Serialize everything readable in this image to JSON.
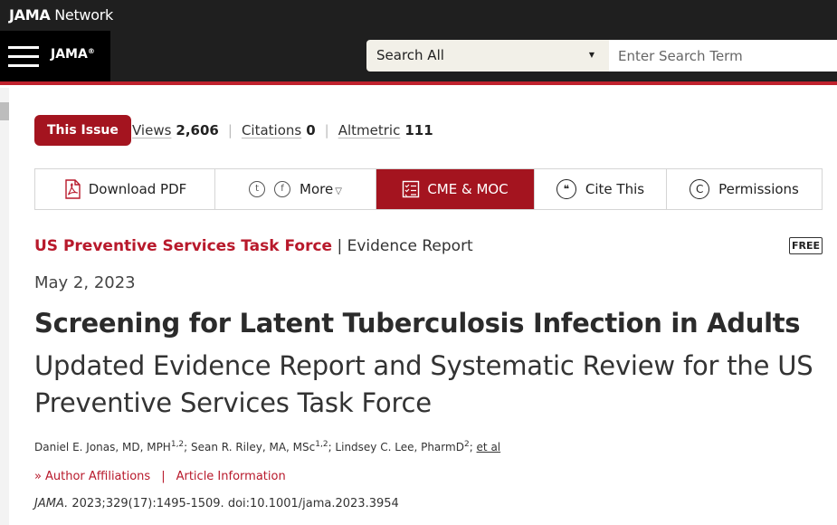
{
  "header": {
    "network_logo_bold": "JAMA",
    "network_logo_light": " Network",
    "jama_logo": "JAMA",
    "jama_logo_mark": "®",
    "search_scope": "Search All",
    "search_placeholder": "Enter Search Term"
  },
  "issue_button": "This Issue",
  "metrics": [
    {
      "label": "Views",
      "value": "2,606"
    },
    {
      "label": "Citations",
      "value": "0"
    },
    {
      "label": "Altmetric",
      "value": "111"
    }
  ],
  "toolbar": {
    "download_pdf": "Download PDF",
    "more": "More",
    "cme": "CME & MOC",
    "cite": "Cite This",
    "permissions": "Permissions",
    "twitter_glyph": "t",
    "facebook_glyph": "f",
    "copyright_glyph": "C",
    "quote_glyph": "❝"
  },
  "article": {
    "category": "US Preventive Services Task Force",
    "separator": " | ",
    "type": "Evidence Report",
    "free_badge": "FREE",
    "date": "May 2, 2023",
    "title": "Screening for Latent Tuberculosis Infection in Adults",
    "subtitle": "Updated Evidence Report and Systematic Review for the US Preventive Services Task Force",
    "authors": [
      {
        "name": "Daniel E. Jonas, MD, MPH",
        "sup": "1,2"
      },
      {
        "name": "Sean R. Riley, MA, MSc",
        "sup": "1,2"
      },
      {
        "name": "Lindsey C. Lee, PharmD",
        "sup": "2"
      }
    ],
    "et_al": "et al",
    "author_affiliations": "Author Affiliations",
    "article_information": "Article Information",
    "journal": "JAMA.",
    "citation_rest": " 2023;329(17):1495-1509. doi:10.1001/jama.2023.3954"
  },
  "colors": {
    "brand_red": "#a4141f",
    "link_red": "#b8192b",
    "header_bg": "#1f1f1f"
  }
}
